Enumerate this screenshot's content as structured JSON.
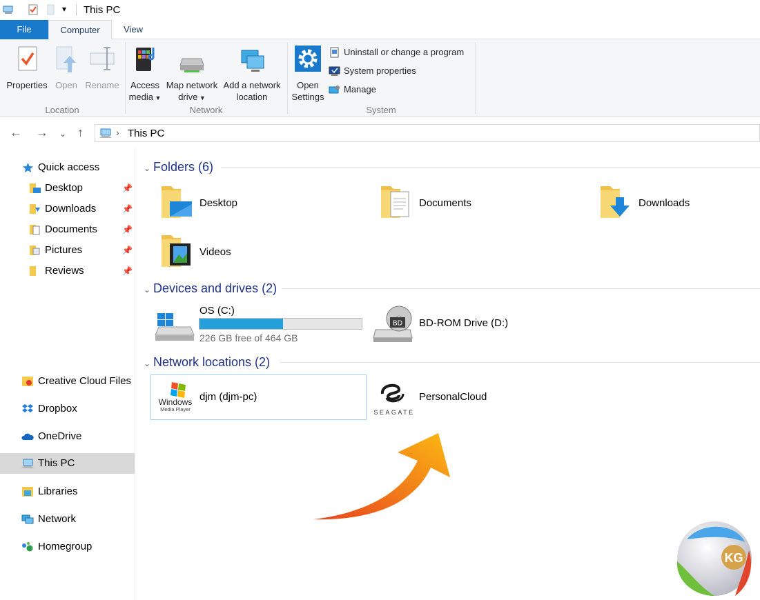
{
  "window": {
    "title": "This PC"
  },
  "ribbon": {
    "tabs": [
      {
        "label": "File"
      },
      {
        "label": "Computer"
      },
      {
        "label": "View"
      }
    ],
    "location": {
      "group_label": "Location",
      "properties": "Properties",
      "open": "Open",
      "rename": "Rename"
    },
    "network": {
      "group_label": "Network",
      "access_media_1": "Access",
      "access_media_2": "media",
      "map_drive_1": "Map network",
      "map_drive_2": "drive",
      "add_location_1": "Add a network",
      "add_location_2": "location"
    },
    "system": {
      "group_label": "System",
      "open_settings_1": "Open",
      "open_settings_2": "Settings",
      "uninstall": "Uninstall or change a program",
      "system_properties": "System properties",
      "manage": "Manage"
    }
  },
  "address": {
    "crumb": "This PC"
  },
  "sidebar": {
    "quick_access": "Quick access",
    "pinned": [
      {
        "label": "Desktop"
      },
      {
        "label": "Downloads"
      },
      {
        "label": "Documents"
      },
      {
        "label": "Pictures"
      },
      {
        "label": "Reviews"
      }
    ],
    "items": [
      {
        "label": "Creative Cloud Files"
      },
      {
        "label": "Dropbox"
      },
      {
        "label": "OneDrive"
      },
      {
        "label": "This PC"
      },
      {
        "label": "Libraries"
      },
      {
        "label": "Network"
      },
      {
        "label": "Homegroup"
      }
    ]
  },
  "content": {
    "folders": {
      "header": "Folders (6)",
      "items": [
        {
          "label": "Desktop"
        },
        {
          "label": "Documents"
        },
        {
          "label": "Downloads"
        },
        {
          "label": "Videos"
        }
      ]
    },
    "drives": {
      "header": "Devices and drives (2)",
      "c_label": "OS (C:)",
      "c_free": "226 GB free of 464 GB",
      "c_used_fraction": 0.513,
      "d_label": "BD-ROM Drive (D:)",
      "bd_badge": "BD"
    },
    "network": {
      "header": "Network locations (2)",
      "item1": "djm (djm-pc)",
      "wmp_line1": "Windows",
      "wmp_line2": "Media Player",
      "item2": "PersonalCloud",
      "seagate": "SEAGATE"
    }
  },
  "watermark": {
    "text": "KG"
  },
  "colors": {
    "accent": "#1979ca",
    "progress": "#26a0da",
    "header_text": "#1e3287",
    "arrow": "#f7931e"
  }
}
